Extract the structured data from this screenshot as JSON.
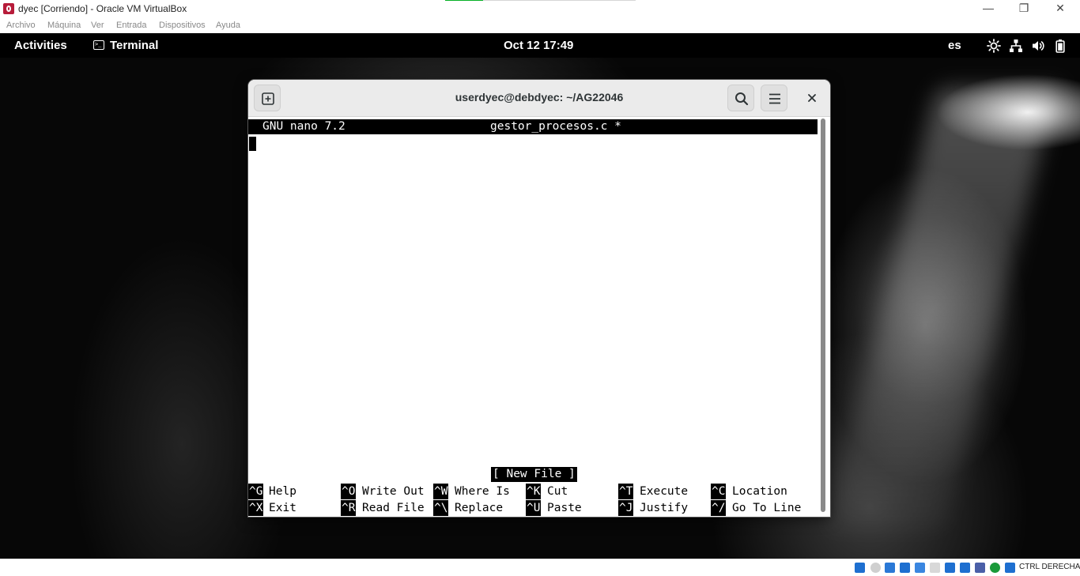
{
  "host_window": {
    "title": "dyec [Corriendo] - Oracle VM VirtualBox",
    "controls": {
      "minimize": "—",
      "restore": "❐",
      "close": "✕"
    },
    "progress": 0.2,
    "menu": [
      "Archivo",
      "Máquina",
      "Ver",
      "Entrada",
      "Dispositivos",
      "Ayuda"
    ]
  },
  "gnome_topbar": {
    "activities": "Activities",
    "app_name": "Terminal",
    "clock": "Oct 12  17:49",
    "keyboard_layout": "es",
    "tray_icons": [
      "brightness-icon",
      "network-icon",
      "volume-icon",
      "battery-icon"
    ]
  },
  "terminal": {
    "title": "userdyec@debdyec: ~/AG22046",
    "buttons": {
      "new_tab": "new-tab-icon",
      "search": "search-icon",
      "menu": "hamburger-menu-icon",
      "close": "×"
    },
    "nano": {
      "version": "GNU nano 7.2",
      "filename": "gestor_procesos.c *",
      "status_message": "[ New File ]",
      "shortcuts_row1": [
        {
          "key": "^G",
          "label": "Help"
        },
        {
          "key": "^O",
          "label": "Write Out"
        },
        {
          "key": "^W",
          "label": "Where Is"
        },
        {
          "key": "^K",
          "label": "Cut"
        },
        {
          "key": "^T",
          "label": "Execute"
        },
        {
          "key": "^C",
          "label": "Location"
        }
      ],
      "shortcuts_row2": [
        {
          "key": "^X",
          "label": "Exit"
        },
        {
          "key": "^R",
          "label": "Read File"
        },
        {
          "key": "^\\",
          "label": "Replace"
        },
        {
          "key": "^U",
          "label": "Paste"
        },
        {
          "key": "^J",
          "label": "Justify"
        },
        {
          "key": "^/",
          "label": "Go To Line"
        }
      ]
    }
  },
  "vb_statusbar": {
    "host_key": "CTRL DERECHA",
    "icons": [
      "hard-disk-icon",
      "optical-drive-icon",
      "audio-icon",
      "network-adapter-icon",
      "usb-icon",
      "shared-folders-icon",
      "display-icon",
      "video-capture-icon",
      "recording-icon",
      "virtualization-icon",
      "arrow-icon",
      "mouse-integration-icon"
    ],
    "icon_colors": {
      "blue": "#1e6fd0",
      "gray": "#b5b5b5",
      "green": "#1a9a3a"
    }
  }
}
